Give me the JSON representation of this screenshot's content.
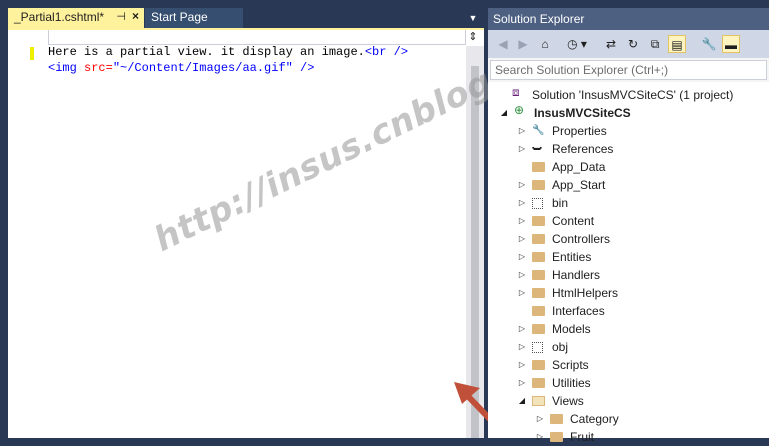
{
  "editor": {
    "tabs": [
      {
        "label": "_Partial1.cshtml*",
        "pin_icon": "pin-icon",
        "close_icon": "close-icon"
      },
      {
        "label": "Start Page"
      }
    ],
    "code": {
      "line1_text": "Here is a partial view. it display an image.",
      "line1_tag": "<br />",
      "line2_open": "<img ",
      "line2_attr": "src=",
      "line2_value": "\"~/Content/Images/aa.gif\"",
      "line2_close": " />"
    }
  },
  "watermark": "http://insus.cnblogs.com",
  "solution_explorer": {
    "title": "Solution Explorer",
    "search_placeholder": "Search Solution Explorer (Ctrl+;)",
    "toolbar_icons": [
      "back-icon",
      "forward-icon",
      "home-icon",
      "history-icon",
      "sync-icon",
      "refresh-icon",
      "collapse-all-icon",
      "show-all-files-icon",
      "properties-wrench-icon",
      "preview-icon"
    ],
    "tree": [
      {
        "label": "Solution 'InsusMVCSiteCS' (1 project)",
        "icon": "solution-icon",
        "level": 0,
        "expander": ""
      },
      {
        "label": "InsusMVCSiteCS",
        "icon": "web-project-icon",
        "level": 1,
        "expander": "expanded",
        "bold": true
      },
      {
        "label": "Properties",
        "icon": "wrench-icon",
        "level": 2,
        "expander": "collapsed"
      },
      {
        "label": "References",
        "icon": "references-icon",
        "level": 2,
        "expander": "collapsed"
      },
      {
        "label": "App_Data",
        "icon": "folder-icon",
        "level": 2,
        "expander": ""
      },
      {
        "label": "App_Start",
        "icon": "folder-icon",
        "level": 2,
        "expander": "collapsed"
      },
      {
        "label": "bin",
        "icon": "hidden-folder-icon",
        "level": 2,
        "expander": "collapsed"
      },
      {
        "label": "Content",
        "icon": "folder-icon",
        "level": 2,
        "expander": "collapsed"
      },
      {
        "label": "Controllers",
        "icon": "folder-icon",
        "level": 2,
        "expander": "collapsed"
      },
      {
        "label": "Entities",
        "icon": "folder-icon",
        "level": 2,
        "expander": "collapsed"
      },
      {
        "label": "Handlers",
        "icon": "folder-icon",
        "level": 2,
        "expander": "collapsed"
      },
      {
        "label": "HtmlHelpers",
        "icon": "folder-icon",
        "level": 2,
        "expander": "collapsed"
      },
      {
        "label": "Interfaces",
        "icon": "folder-icon",
        "level": 2,
        "expander": ""
      },
      {
        "label": "Models",
        "icon": "folder-icon",
        "level": 2,
        "expander": "collapsed"
      },
      {
        "label": "obj",
        "icon": "hidden-folder-icon",
        "level": 2,
        "expander": "collapsed"
      },
      {
        "label": "Scripts",
        "icon": "folder-icon",
        "level": 2,
        "expander": "collapsed"
      },
      {
        "label": "Utilities",
        "icon": "folder-icon",
        "level": 2,
        "expander": "collapsed"
      },
      {
        "label": "Views",
        "icon": "open-folder-icon",
        "level": 2,
        "expander": "expanded"
      },
      {
        "label": "Category",
        "icon": "folder-icon",
        "level": 3,
        "expander": "collapsed"
      },
      {
        "label": "Fruit",
        "icon": "folder-icon",
        "level": 3,
        "expander": "collapsed"
      }
    ]
  },
  "colors": {
    "ide_background": "#293955",
    "active_tab": "#fff29d",
    "panel_title": "#4d6082",
    "arrow": "#c0503a"
  }
}
